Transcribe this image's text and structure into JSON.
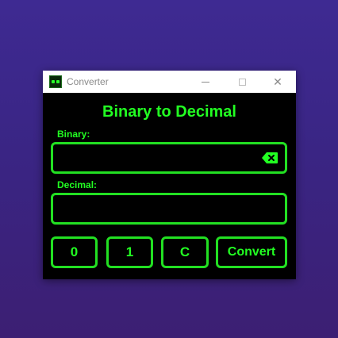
{
  "window": {
    "title": "Converter",
    "icon": "app-icon"
  },
  "controls": {
    "minimize": "minimize-icon",
    "maximize": "maximize-icon",
    "close_glyph": "✕"
  },
  "main": {
    "heading": "Binary to Decimal",
    "binary_label": "Binary:",
    "binary_value": "",
    "decimal_label": "Decimal:",
    "decimal_value": ""
  },
  "buttons": {
    "zero": "0",
    "one": "1",
    "clear": "C",
    "convert": "Convert"
  },
  "colors": {
    "accent": "#22ff22",
    "background": "#000000"
  }
}
